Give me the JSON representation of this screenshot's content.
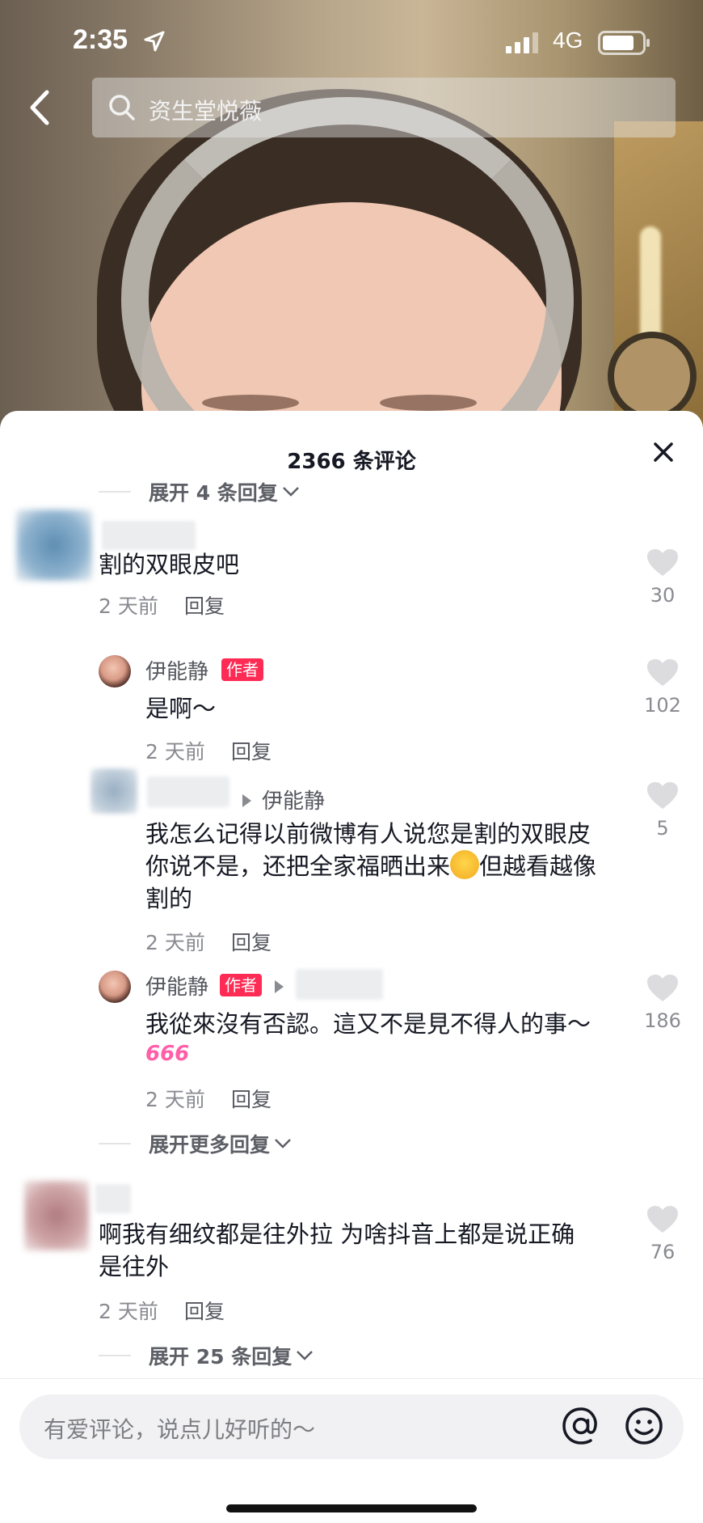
{
  "status": {
    "time": "2:35",
    "network": "4G"
  },
  "search": {
    "query": "资生堂悦薇"
  },
  "sheet": {
    "title": "2366 条评论",
    "expand_top": "展开 4 条回复",
    "expand_more": "展开更多回复",
    "expand_bottom": "展开 25 条回复"
  },
  "comments": [
    {
      "text": "割的双眼皮吧",
      "time": "2 天前",
      "reply": "回复",
      "likes": "30"
    },
    {
      "name": "伊能静",
      "badge": "作者",
      "text": "是啊～",
      "time": "2 天前",
      "reply": "回复",
      "likes": "102"
    },
    {
      "reply_to": "伊能静",
      "text_line1": "我怎么记得以前微博有人说您是割的双眼皮",
      "text_line2a": "你说不是，还把全家福晒出来",
      "text_line2b": "但越看越像",
      "text_line3": "割的",
      "time": "2 天前",
      "reply": "回复",
      "likes": "5"
    },
    {
      "name": "伊能静",
      "badge": "作者",
      "text": "我從來沒有否認。這又不是見不得人的事～",
      "sticker": "666",
      "time": "2 天前",
      "reply": "回复",
      "likes": "186"
    },
    {
      "text_line1": "啊我有细纹都是往外拉 为啥抖音上都是说正确",
      "text_line2": "是往外",
      "time": "2 天前",
      "reply": "回复",
      "likes": "76"
    }
  ],
  "input": {
    "placeholder": "有爱评论，说点儿好听的～"
  },
  "colors": {
    "accent": "#fe2c55",
    "text": "#161823",
    "secondary": "#8a8b91"
  }
}
